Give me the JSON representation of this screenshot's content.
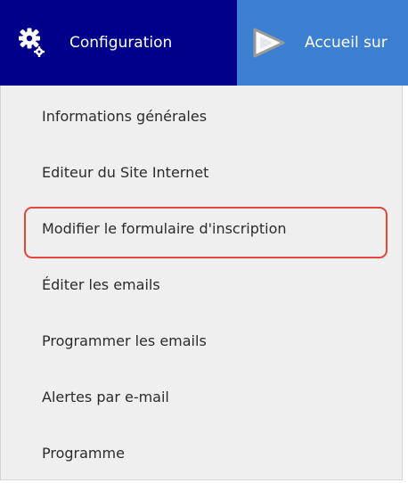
{
  "nav": {
    "configuration": {
      "label": "Configuration",
      "icon": "gear-icon"
    },
    "home": {
      "label": "Accueil sur",
      "icon": "play-icon"
    }
  },
  "menu": {
    "items": [
      {
        "label": "Informations générales"
      },
      {
        "label": "Editeur du Site Internet"
      },
      {
        "label": "Modifier le formulaire d'inscription",
        "highlighted": true
      },
      {
        "label": "Éditer les emails"
      },
      {
        "label": "Programmer les emails"
      },
      {
        "label": "Alertes par e-mail"
      },
      {
        "label": "Programme"
      }
    ]
  },
  "colors": {
    "config_tab_bg": "#00008b",
    "home_tab_bg": "#3d7fd0",
    "dropdown_bg": "#efefef",
    "highlight_border": "#e0493c"
  }
}
